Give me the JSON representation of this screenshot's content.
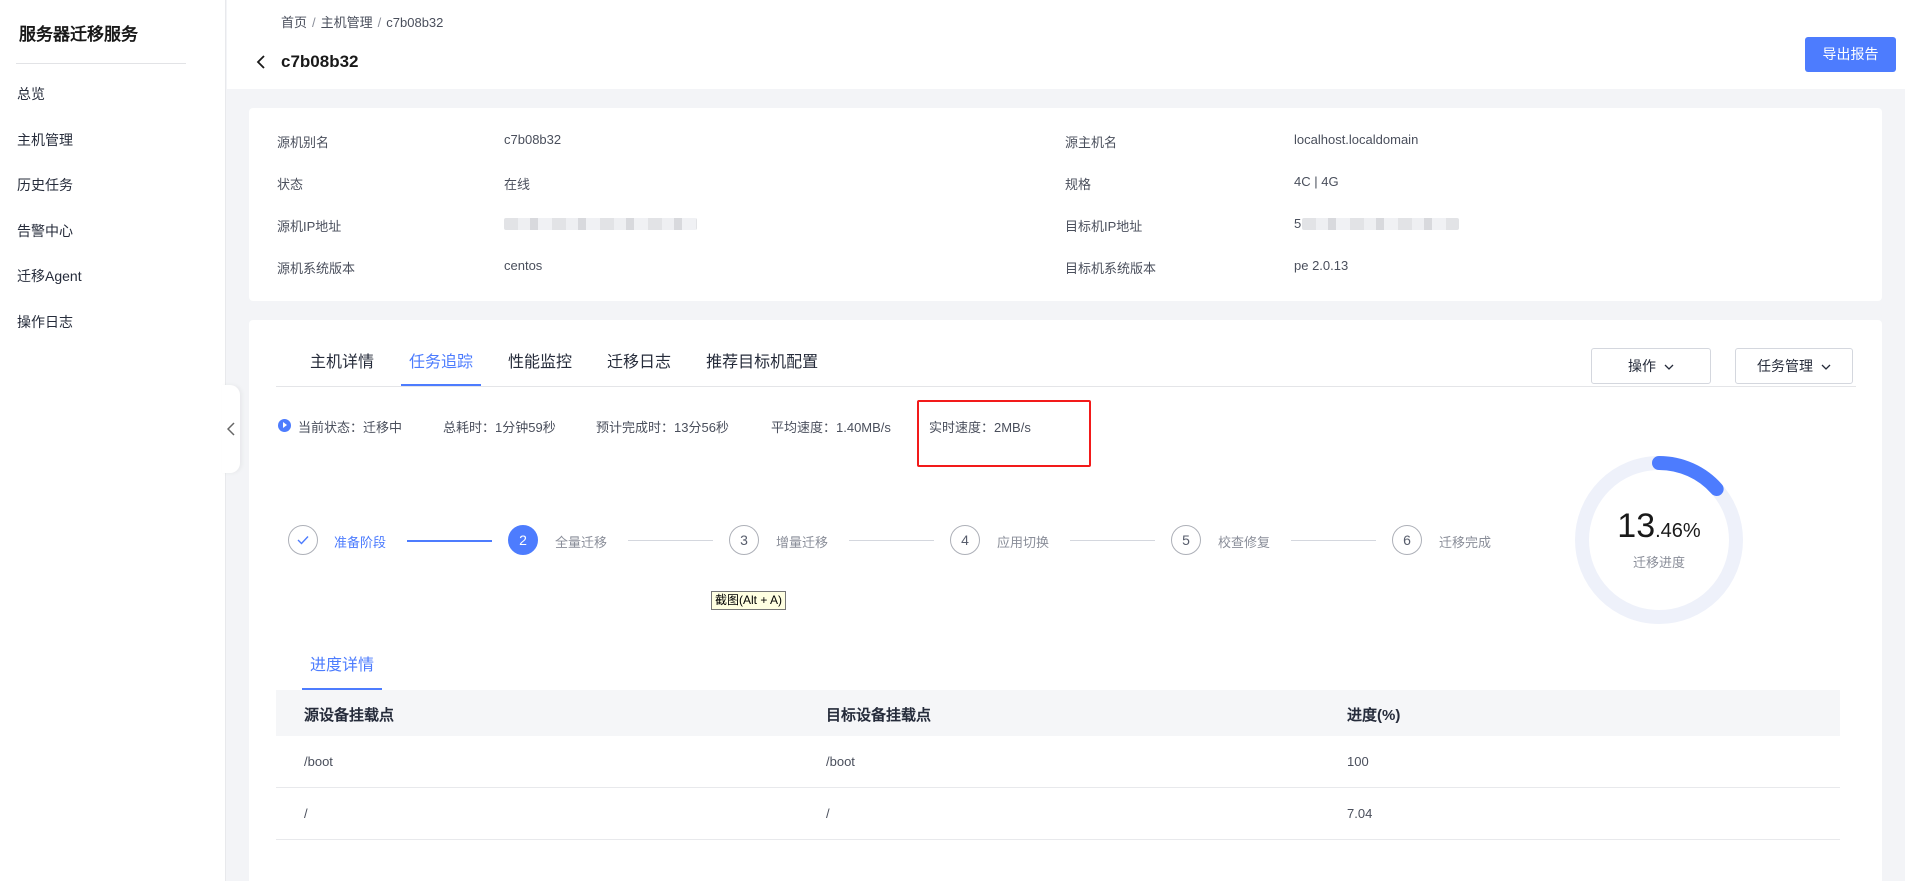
{
  "sidebar": {
    "title": "服务器迁移服务",
    "items": [
      {
        "label": "总览"
      },
      {
        "label": "主机管理"
      },
      {
        "label": "历史任务"
      },
      {
        "label": "告警中心"
      },
      {
        "label": "迁移Agent"
      },
      {
        "label": "操作日志"
      }
    ]
  },
  "header": {
    "breadcrumb": [
      "首页",
      "主机管理",
      "c7b08b32"
    ],
    "title": "c7b08b32",
    "export_label": "导出报告"
  },
  "info": {
    "source_alias_label": "源机别名",
    "source_alias": "c7b08b32",
    "status_label": "状态",
    "status": "在线",
    "source_ip_label": "源机IP地址",
    "source_os_label": "源机系统版本",
    "source_os": "centos",
    "source_host_label": "源主机名",
    "source_host": "localhost.localdomain",
    "spec_label": "规格",
    "spec": "4C | 4G",
    "target_ip_label": "目标机IP地址",
    "target_ip_visible": "5",
    "target_os_label": "目标机系统版本",
    "target_os": "pe 2.0.13"
  },
  "tabs": [
    {
      "label": "主机详情"
    },
    {
      "label": "任务追踪",
      "active": true
    },
    {
      "label": "性能监控"
    },
    {
      "label": "迁移日志"
    },
    {
      "label": "推荐目标机配置"
    }
  ],
  "actions": {
    "operate_label": "操作",
    "task_manage_label": "任务管理"
  },
  "status": {
    "current_state": "当前状态：迁移中",
    "elapsed": "总耗时：1分钟59秒",
    "eta": "预计完成时：13分56秒",
    "avg_speed": "平均速度：1.40MB/s",
    "realtime_speed": "实时速度：2MB/s"
  },
  "steps": [
    {
      "number": "",
      "label": "准备阶段",
      "state": "done"
    },
    {
      "number": "2",
      "label": "全量迁移",
      "state": "active"
    },
    {
      "number": "3",
      "label": "增量迁移",
      "state": "pending"
    },
    {
      "number": "4",
      "label": "应用切换",
      "state": "pending"
    },
    {
      "number": "5",
      "label": "校查修复",
      "state": "pending"
    },
    {
      "number": "6",
      "label": "迁移完成",
      "state": "pending"
    }
  ],
  "tooltip": "截图(Alt + A)",
  "gauge": {
    "progress_int": "13",
    "progress_dec": ".46%",
    "progress_fraction": 0.1346,
    "label": "迁移进度",
    "accent": "#4d7cfe",
    "track": "#eef1fa"
  },
  "progress_details": {
    "tab_label": "进度详情",
    "columns": [
      "源设备挂载点",
      "目标设备挂载点",
      "进度(%)"
    ],
    "rows": [
      [
        "/boot",
        "/boot",
        "100"
      ],
      [
        "/",
        "/",
        "7.04"
      ]
    ]
  }
}
